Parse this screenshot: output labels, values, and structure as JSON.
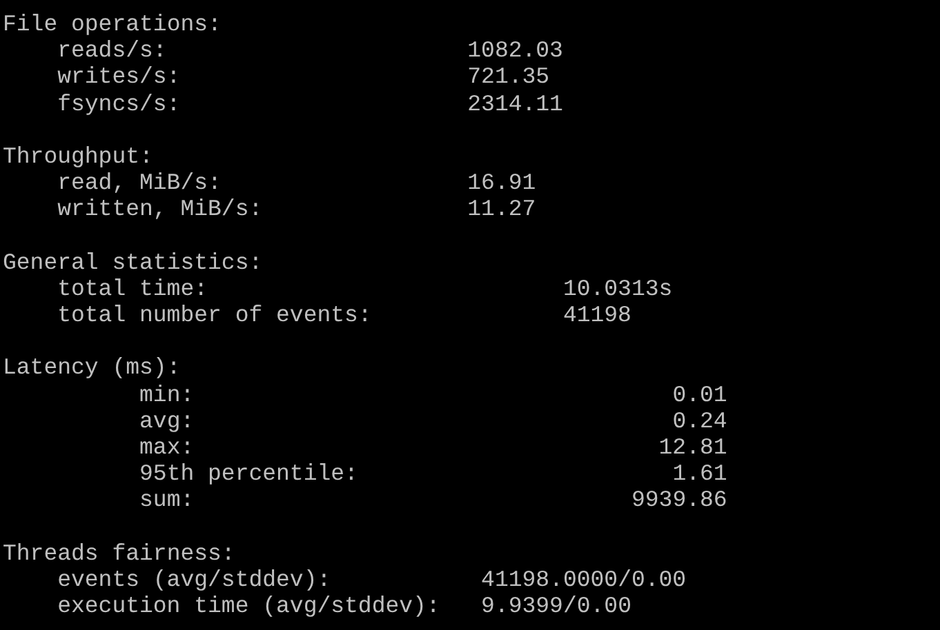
{
  "sections": [
    {
      "title": "File operations:",
      "rows": [
        {
          "label": "reads/s:",
          "value": "1082.03"
        },
        {
          "label": "writes/s:",
          "value": "721.35"
        },
        {
          "label": "fsyncs/s:",
          "value": "2314.11"
        }
      ]
    },
    {
      "title": "Throughput:",
      "rows": [
        {
          "label": "read, MiB/s:",
          "value": "16.91"
        },
        {
          "label": "written, MiB/s:",
          "value": "11.27"
        }
      ]
    },
    {
      "title": "General statistics:",
      "rows": [
        {
          "label": "total time:",
          "value": "10.0313s"
        },
        {
          "label": "total number of events:",
          "value": "41198"
        }
      ]
    },
    {
      "title": "Latency (ms):",
      "rows": [
        {
          "label": "min:",
          "value": "0.01"
        },
        {
          "label": "avg:",
          "value": "0.24"
        },
        {
          "label": "max:",
          "value": "12.81"
        },
        {
          "label": "95th percentile:",
          "value": "1.61"
        },
        {
          "label": "sum:",
          "value": "9939.86"
        }
      ]
    },
    {
      "title": "Threads fairness:",
      "rows": [
        {
          "label": "events (avg/stddev):",
          "value": "41198.0000/0.00"
        },
        {
          "label": "execution time (avg/stddev):",
          "value": "9.9399/0.00"
        }
      ]
    }
  ]
}
